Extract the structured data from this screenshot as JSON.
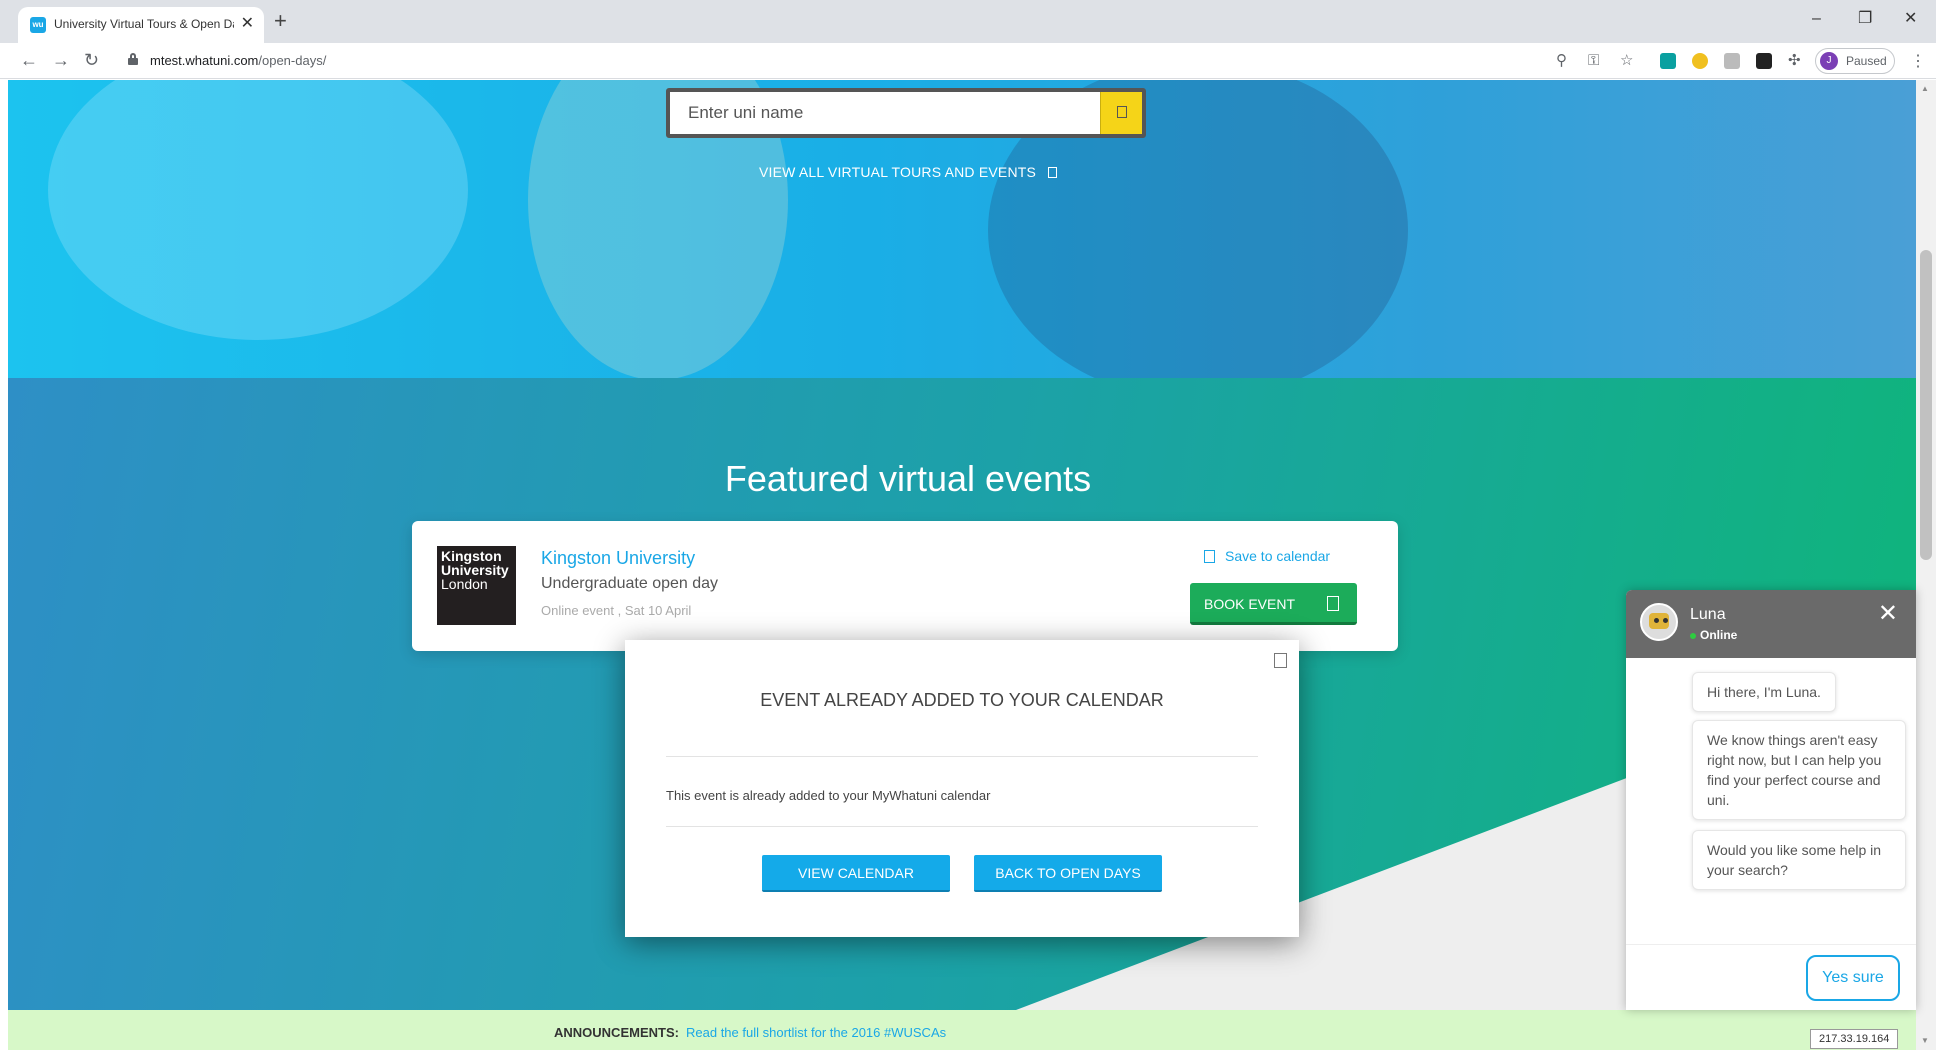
{
  "browser": {
    "tab_title": "University Virtual Tours & Open Days",
    "tab_close": "✕",
    "new_tab": "+",
    "favicon_text": "wu",
    "url_host": "mtest.whatuni.com",
    "url_path": "/open-days/",
    "profile_initial": "J",
    "profile_status": "Paused",
    "window_minimize": "–",
    "window_restore": "❐",
    "window_close": "✕"
  },
  "hero": {
    "search_placeholder": "Enter uni name",
    "view_all_label": "VIEW ALL VIRTUAL TOURS AND EVENTS"
  },
  "featured": {
    "title": "Featured virtual events",
    "event": {
      "logo_line1": "Kingston",
      "logo_line2": "University",
      "logo_line3": "London",
      "university": "Kingston University",
      "event_type": "Undergraduate open day",
      "details": "Online event , Sat 10 April",
      "save_label": "Save to calendar",
      "book_label": "BOOK EVENT"
    }
  },
  "modal": {
    "title": "EVENT ALREADY ADDED TO YOUR CALENDAR",
    "message": "This event is already added to your MyWhatuni calendar",
    "view_calendar_label": "VIEW CALENDAR",
    "back_label": "BACK TO OPEN DAYS"
  },
  "chat": {
    "bot_name": "Luna",
    "status": "Online",
    "close": "✕",
    "messages": [
      "Hi there, I'm Luna.",
      "We know things aren't easy right now, but I can help you find your perfect course and uni.",
      "Would you like some help in your search?"
    ],
    "reply_label": "Yes sure"
  },
  "announcement": {
    "label": "ANNOUNCEMENTS:",
    "link": "Read the full shortlist for the 2016 #WUSCAs"
  },
  "ip_address": "217.33.19.164",
  "colors": {
    "brand_blue": "#1aa7e6",
    "book_green": "#1cac5a",
    "search_yellow": "#f5d418"
  }
}
